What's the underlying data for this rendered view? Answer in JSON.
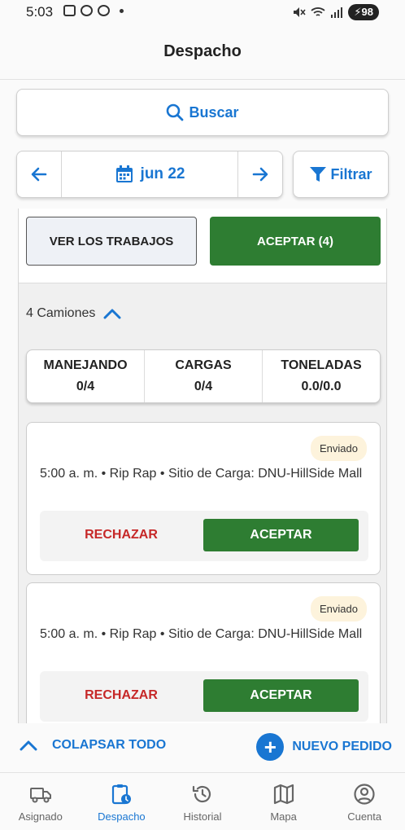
{
  "status_bar": {
    "time": "5:03",
    "battery": "98"
  },
  "app_bar": {
    "title": "Despacho"
  },
  "search": {
    "label": "Buscar"
  },
  "date_nav": {
    "date": "jun 22"
  },
  "filter": {
    "label": "Filtrar"
  },
  "panel": {
    "view_jobs_label": "VER LOS TRABAJOS",
    "accept_all_label": "ACEPTAR (4)",
    "trucks_label": "4 Camiones",
    "stats": [
      {
        "label": "MANEJANDO",
        "value": "0/4"
      },
      {
        "label": "CARGAS",
        "value": "0/4"
      },
      {
        "label": "TONELADAS",
        "value": "0.0/0.0"
      }
    ],
    "jobs": [
      {
        "status": "Enviado",
        "description": "5:00 a. m. • Rip Rap • Sitio de Carga: DNU-HillSide Mall",
        "reject_label": "RECHAZAR",
        "accept_label": "ACEPTAR"
      },
      {
        "status": "Enviado",
        "description": "5:00 a. m. • Rip Rap • Sitio de Carga: DNU-HillSide Mall",
        "reject_label": "RECHAZAR",
        "accept_label": "ACEPTAR"
      }
    ]
  },
  "footer": {
    "collapse_all_label": "COLAPSAR TODO",
    "new_order_label": "NUEVO PEDIDO"
  },
  "bottom_nav": [
    {
      "label": "Asignado",
      "icon": "truck-icon"
    },
    {
      "label": "Despacho",
      "icon": "clipboard-clock-icon",
      "active": true
    },
    {
      "label": "Historial",
      "icon": "history-icon"
    },
    {
      "label": "Mapa",
      "icon": "map-icon"
    },
    {
      "label": "Cuenta",
      "icon": "account-icon"
    }
  ],
  "colors": {
    "primary": "#1976d2",
    "accept_green": "#2e7d32",
    "reject_red": "#c62828",
    "badge_bg": "#fdf3dc"
  }
}
